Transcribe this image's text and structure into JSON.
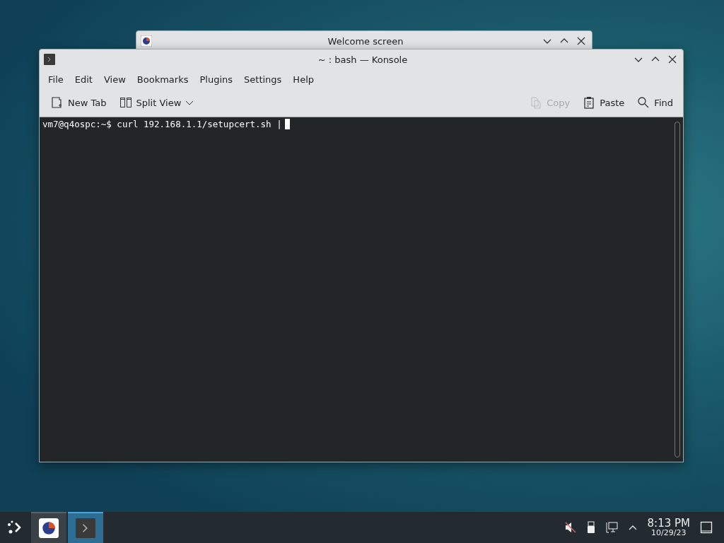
{
  "windows": [
    {
      "kind": "background",
      "title": "Welcome screen"
    },
    {
      "kind": "terminal",
      "title": "~ : bash — Konsole",
      "menu": [
        "File",
        "Edit",
        "View",
        "Bookmarks",
        "Plugins",
        "Settings",
        "Help"
      ],
      "toolbar_left": [
        {
          "label": "New Tab",
          "disabled": false
        },
        {
          "label": "Split View",
          "disabled": false
        }
      ],
      "toolbar_right": [
        {
          "label": "Copy",
          "disabled": true
        },
        {
          "label": "Paste",
          "disabled": false
        },
        {
          "label": "Find",
          "disabled": false
        }
      ],
      "prompt": "vm7@q4ospc:~$",
      "command": "curl 192.168.1.1/setupcert.sh |"
    }
  ],
  "taskbar": {
    "tasks": [
      {
        "selected": false
      },
      {
        "selected": true
      }
    ],
    "time": "8:13 PM",
    "date": "10/29/23"
  }
}
